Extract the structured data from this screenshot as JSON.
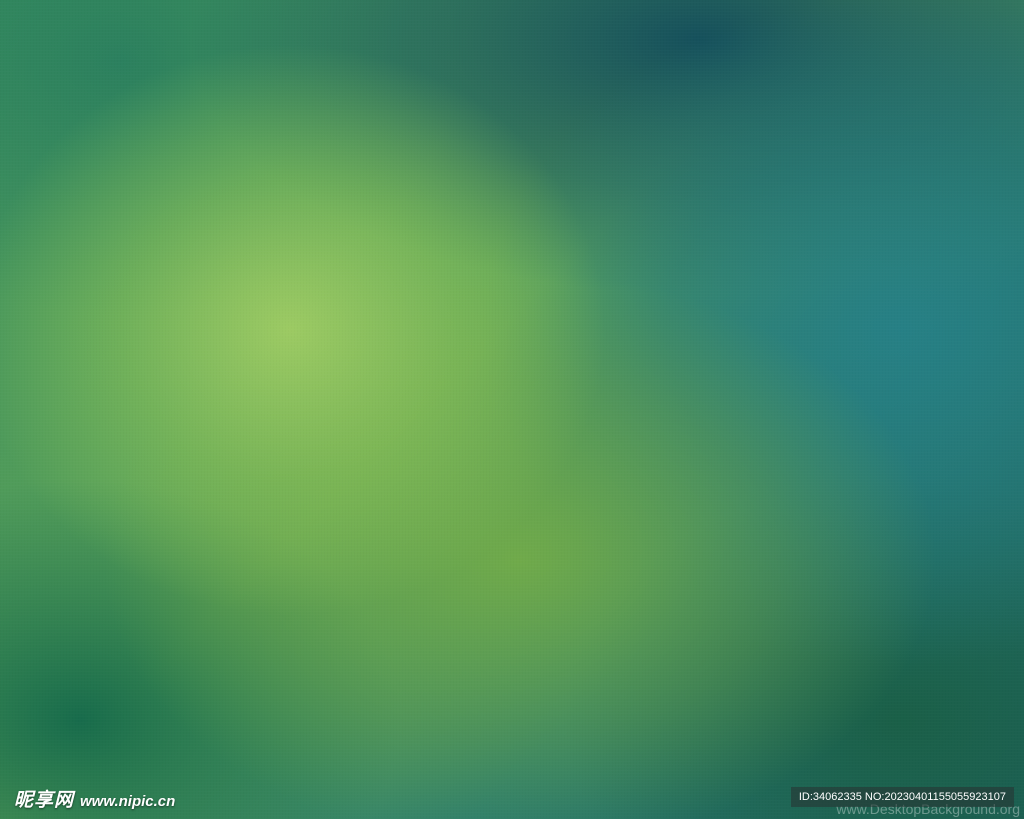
{
  "image": {
    "description_colors": {
      "light_green": "#a0cd64",
      "mid_green": "#6aa84f",
      "teal": "#26808a",
      "dark_teal": "#134c5c",
      "dark_green": "#14694b"
    }
  },
  "watermarks": {
    "logo_cn": "昵享网",
    "logo_url": "www.nipic.cn",
    "id_text": "ID:34062335 NO:20230401155055923107",
    "site_text": "www.DesktopBackground.org"
  }
}
